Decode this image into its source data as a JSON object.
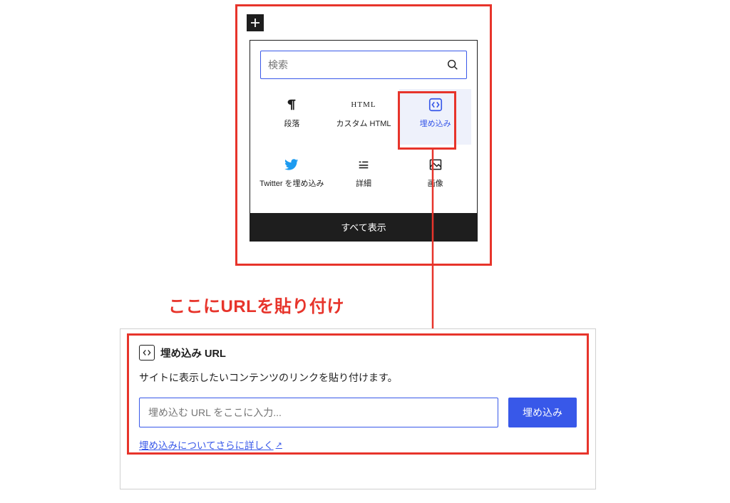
{
  "inserter": {
    "search_placeholder": "検索",
    "blocks": {
      "paragraph": "段落",
      "custom_html": "カスタム HTML",
      "html_glyph": "HTML",
      "embed": "埋め込み",
      "twitter": "Twitter を埋め込み",
      "details": "詳細",
      "image": "画像"
    },
    "show_all": "すべて表示"
  },
  "annotation": "ここにURLを貼り付け",
  "embed_panel": {
    "title": "埋め込み URL",
    "description": "サイトに表示したいコンテンツのリンクを貼り付けます。",
    "input_placeholder": "埋め込む URL をここに入力...",
    "button": "埋め込み",
    "learn_more": "埋め込みについてさらに詳しく"
  }
}
